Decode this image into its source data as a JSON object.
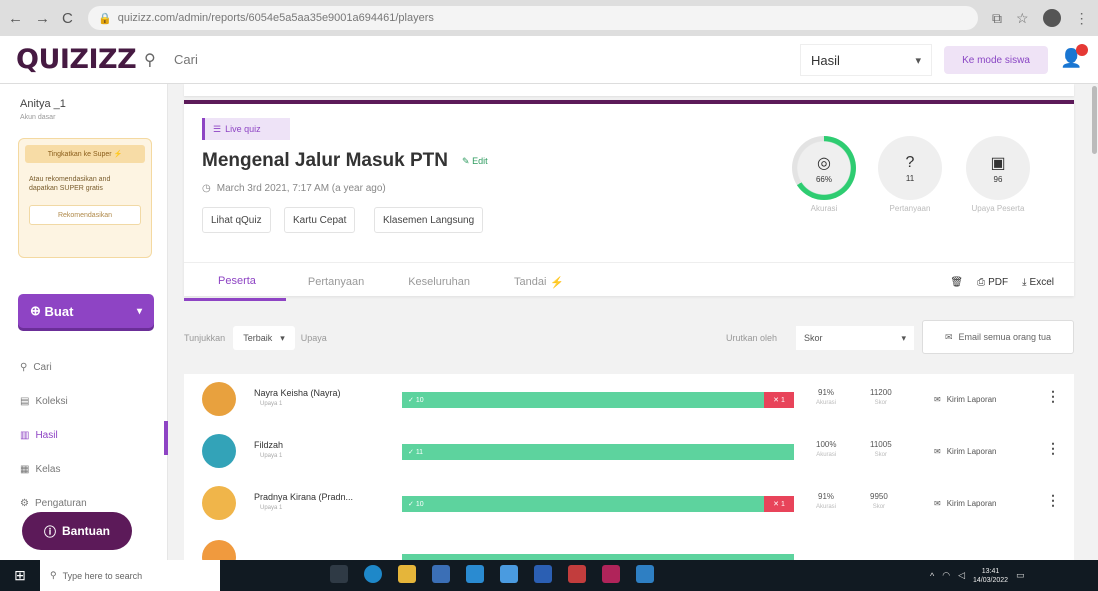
{
  "browser": {
    "url": "quizizz.com/admin/reports/6054e5a5aa35e9001a694461/players",
    "nav_back": "←",
    "nav_forward": "→",
    "nav_reload": "C"
  },
  "header": {
    "logo": "QUIZIZZ",
    "search_placeholder": "Cari",
    "select_value": "Hasil",
    "student_mode_label": "Ke mode siswa"
  },
  "sidebar": {
    "username": "Anitya _1",
    "user_role": "Akun dasar",
    "upgrade_label": "Tingkatkan ke Super",
    "upgrade_text": "Atau rekomendasikan and dapatkan SUPER gratis",
    "recommend_label": "Rekomendasikan",
    "create_label": "Buat",
    "nav": [
      {
        "label": "Cari",
        "icon": "search"
      },
      {
        "label": "Koleksi",
        "icon": "collection"
      },
      {
        "label": "Hasil",
        "icon": "results"
      },
      {
        "label": "Kelas",
        "icon": "classes"
      },
      {
        "label": "Pengaturan",
        "icon": "settings"
      }
    ],
    "help_label": "Bantuan"
  },
  "quiz": {
    "badge": "Live quiz",
    "title": "Mengenal Jalur Masuk PTN",
    "edit_label": "Edit",
    "date": "March 3rd 2021, 7:17 AM (a year ago)",
    "links": [
      "Lihat qQuiz",
      "Kartu Cepat",
      "Klasemen Langsung"
    ]
  },
  "stats": [
    {
      "value": "66%",
      "label": "Akurasi",
      "progress": 0.66
    },
    {
      "value": "11",
      "label": "Pertanyaan"
    },
    {
      "value": "96",
      "label": "Upaya Peserta"
    }
  ],
  "tabs": {
    "items": [
      "Peserta",
      "Pertanyaan",
      "Keseluruhan",
      "Tandai"
    ],
    "pdf_label": "PDF",
    "excel_label": "Excel"
  },
  "filters": {
    "show_label": "Tunjukkan",
    "show_value": "Terbaik",
    "attempt_label": "Upaya",
    "sort_label": "Urutkan oleh",
    "sort_value": "Skor",
    "email_label": "Email semua orang tua"
  },
  "players": [
    {
      "name": "Nayra Keisha (Nayra)",
      "attempt": "Upaya 1",
      "correct": "10",
      "wrong": "1",
      "accuracy": "91%",
      "accuracy_label": "Akurasi",
      "score": "11200",
      "score_label": "Skor",
      "report_label": "Kirim Laporan",
      "avatar_color": "#e8a13e"
    },
    {
      "name": "Fildzah",
      "attempt": "Upaya 1",
      "correct": "11",
      "wrong": "",
      "accuracy": "100%",
      "accuracy_label": "Akurasi",
      "score": "11005",
      "score_label": "Skor",
      "report_label": "Kirim Laporan",
      "avatar_color": "#33a3b8"
    },
    {
      "name": "Pradnya Kirana (Pradn...",
      "attempt": "Upaya 1",
      "correct": "10",
      "wrong": "1",
      "accuracy": "91%",
      "accuracy_label": "Akurasi",
      "score": "9950",
      "score_label": "Skor",
      "report_label": "Kirim Laporan",
      "avatar_color": "#f0b54a"
    }
  ],
  "taskbar": {
    "search_placeholder": "Type here to search",
    "time": "13:41",
    "date": "14/03/2022"
  }
}
